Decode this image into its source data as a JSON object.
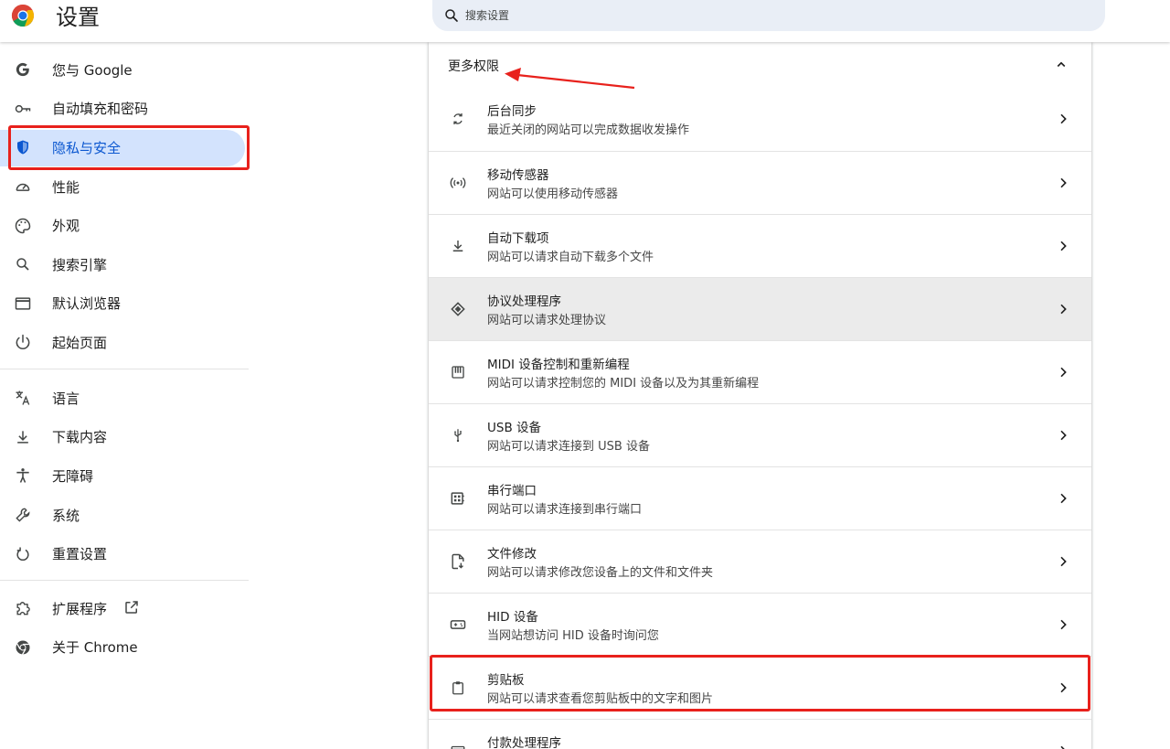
{
  "header": {
    "title": "设置",
    "search_placeholder": "搜索设置"
  },
  "sidebar": {
    "items": [
      {
        "label": "您与 Google",
        "icon": "google-icon"
      },
      {
        "label": "自动填充和密码",
        "icon": "key-icon"
      },
      {
        "label": "隐私与安全",
        "icon": "shield-icon",
        "active": true
      },
      {
        "label": "性能",
        "icon": "speedometer-icon"
      },
      {
        "label": "外观",
        "icon": "palette-icon"
      },
      {
        "label": "搜索引擎",
        "icon": "search-icon"
      },
      {
        "label": "默认浏览器",
        "icon": "browser-window-icon"
      },
      {
        "label": "起始页面",
        "icon": "power-icon"
      },
      {
        "label": "语言",
        "icon": "translate-icon"
      },
      {
        "label": "下载内容",
        "icon": "download-icon"
      },
      {
        "label": "无障碍",
        "icon": "accessibility-icon"
      },
      {
        "label": "系统",
        "icon": "wrench-icon"
      },
      {
        "label": "重置设置",
        "icon": "reset-icon"
      },
      {
        "label": "扩展程序",
        "icon": "puzzle-icon"
      },
      {
        "label": "关于 Chrome",
        "icon": "chrome-icon"
      }
    ]
  },
  "main": {
    "section_title": "更多权限",
    "permissions": [
      {
        "title": "后台同步",
        "desc": "最近关闭的网站可以完成数据收发操作",
        "icon": "sync-icon"
      },
      {
        "title": "移动传感器",
        "desc": "网站可以使用移动传感器",
        "icon": "sensor-icon"
      },
      {
        "title": "自动下载项",
        "desc": "网站可以请求自动下载多个文件",
        "icon": "download-icon"
      },
      {
        "title": "协议处理程序",
        "desc": "网站可以请求处理协议",
        "icon": "protocol-handler-icon"
      },
      {
        "title": "MIDI 设备控制和重新编程",
        "desc": "网站可以请求控制您的 MIDI 设备以及为其重新编程",
        "icon": "piano-icon"
      },
      {
        "title": "USB 设备",
        "desc": "网站可以请求连接到 USB 设备",
        "icon": "usb-icon"
      },
      {
        "title": "串行端口",
        "desc": "网站可以请求连接到串行端口",
        "icon": "serial-port-icon"
      },
      {
        "title": "文件修改",
        "desc": "网站可以请求修改您设备上的文件和文件夹",
        "icon": "file-edit-icon"
      },
      {
        "title": "HID 设备",
        "desc": "当网站想访问 HID 设备时询问您",
        "icon": "gamepad-icon"
      },
      {
        "title": "剪贴板",
        "desc": "网站可以请求查看您剪贴板中的文字和图片",
        "icon": "clipboard-icon"
      },
      {
        "title": "付款处理程序",
        "desc": "",
        "icon": "payment-icon"
      }
    ]
  },
  "colors": {
    "accent": "#0b57d0",
    "active_bg": "#d3e3fd",
    "annotation": "#e8211c",
    "search_bg": "#e9eef6"
  }
}
